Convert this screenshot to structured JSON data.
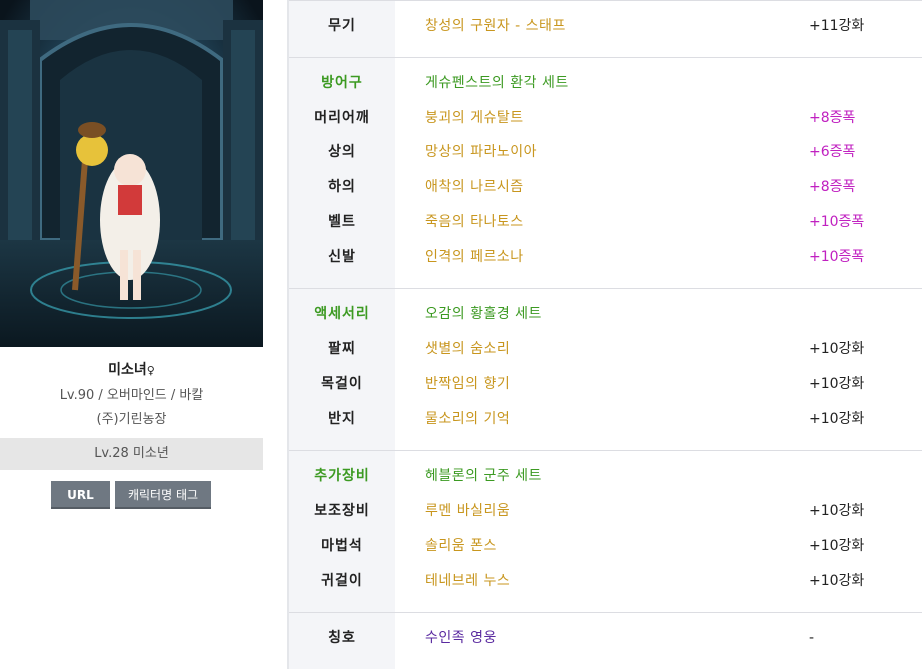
{
  "profile": {
    "name": "미소녀",
    "name_mark": "♀",
    "info": "Lv.90 / 오버마인드 / 바칼",
    "guild": "(주)기린농장",
    "sub_character": "Lv.28 미소년",
    "url_button": "URL",
    "tag_button": "캐릭터명 태그"
  },
  "equipment": {
    "weapon": {
      "label": "무기",
      "item": "창성의 구원자 - 스태프",
      "enhance": "+11강화"
    },
    "armor": {
      "label": "방어구",
      "set": "게슈펜스트의 환각 세트",
      "items": [
        {
          "label": "머리어깨",
          "item": "붕괴의 게슈탈트",
          "enhance": "+8증폭"
        },
        {
          "label": "상의",
          "item": "망상의 파라노이아",
          "enhance": "+6증폭"
        },
        {
          "label": "하의",
          "item": "애착의 나르시즘",
          "enhance": "+8증폭"
        },
        {
          "label": "벨트",
          "item": "죽음의 타나토스",
          "enhance": "+10증폭"
        },
        {
          "label": "신발",
          "item": "인격의 페르소나",
          "enhance": "+10증폭"
        }
      ]
    },
    "accessory": {
      "label": "액세서리",
      "set": "오감의 황홀경 세트",
      "items": [
        {
          "label": "팔찌",
          "item": "샛별의 숨소리",
          "enhance": "+10강화"
        },
        {
          "label": "목걸이",
          "item": "반짝임의 향기",
          "enhance": "+10강화"
        },
        {
          "label": "반지",
          "item": "물소리의 기억",
          "enhance": "+10강화"
        }
      ]
    },
    "extra": {
      "label": "추가장비",
      "set": "헤블론의 군주 세트",
      "items": [
        {
          "label": "보조장비",
          "item": "루멘 바실리움",
          "enhance": "+10강화"
        },
        {
          "label": "마법석",
          "item": "솔리움 폰스",
          "enhance": "+10강화"
        },
        {
          "label": "귀걸이",
          "item": "테네브레 누스",
          "enhance": "+10강화"
        }
      ]
    },
    "title_slot": {
      "label": "칭호",
      "item": "수인족 영웅",
      "enhance": "-"
    }
  },
  "colors": {
    "category_green": "#3c9a22",
    "item_gold": "#c8961e",
    "amplify_magenta": "#c020c0",
    "title_purple": "#5a2aa0",
    "button_gray": "#6f7882"
  }
}
